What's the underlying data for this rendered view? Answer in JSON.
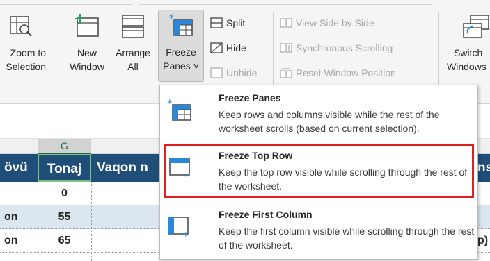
{
  "ribbon": {
    "zoom_selection": {
      "line1": "Zoom to",
      "line2": "Selection"
    },
    "new_window": {
      "line1": "New",
      "line2": "Window"
    },
    "arrange_all": {
      "line1": "Arrange",
      "line2": "All"
    },
    "freeze_panes": {
      "line1": "Freeze",
      "line2": "Panes ˅"
    },
    "split": "Split",
    "hide": "Hide",
    "unhide": "Unhide",
    "view_side_by_side": "View Side by Side",
    "synchronous_scrolling": "Synchronous Scrolling",
    "reset_window_position": "Reset Window Position",
    "switch_windows": {
      "line1": "Switch",
      "line2": "Windows"
    }
  },
  "sheet": {
    "column_g": "G",
    "header": {
      "col_f": "övü",
      "col_g": "Tonaj",
      "col_h": "Vaqon n",
      "col_right": "ns"
    },
    "rows": [
      {
        "f": "",
        "g": "0",
        "right": ""
      },
      {
        "f": "on",
        "g": "55",
        "right": ""
      },
      {
        "f": "on",
        "g": "65",
        "right": "p)"
      }
    ]
  },
  "menu": {
    "items": [
      {
        "title": "Freeze Panes",
        "desc": "Keep rows and columns visible while the rest of the worksheet scrolls (based on current selection)."
      },
      {
        "title": "Freeze Top Row",
        "desc": "Keep the top row visible while scrolling through the rest of the worksheet."
      },
      {
        "title": "Freeze First Column",
        "desc": "Keep the first column visible while scrolling through the rest of the worksheet."
      }
    ]
  },
  "colors": {
    "header_blue": "#1f4e79",
    "row_alt": "#dce6f1",
    "highlight": "#e02020",
    "accent_icon": "#2b88d8",
    "excel_green": "#217346"
  }
}
